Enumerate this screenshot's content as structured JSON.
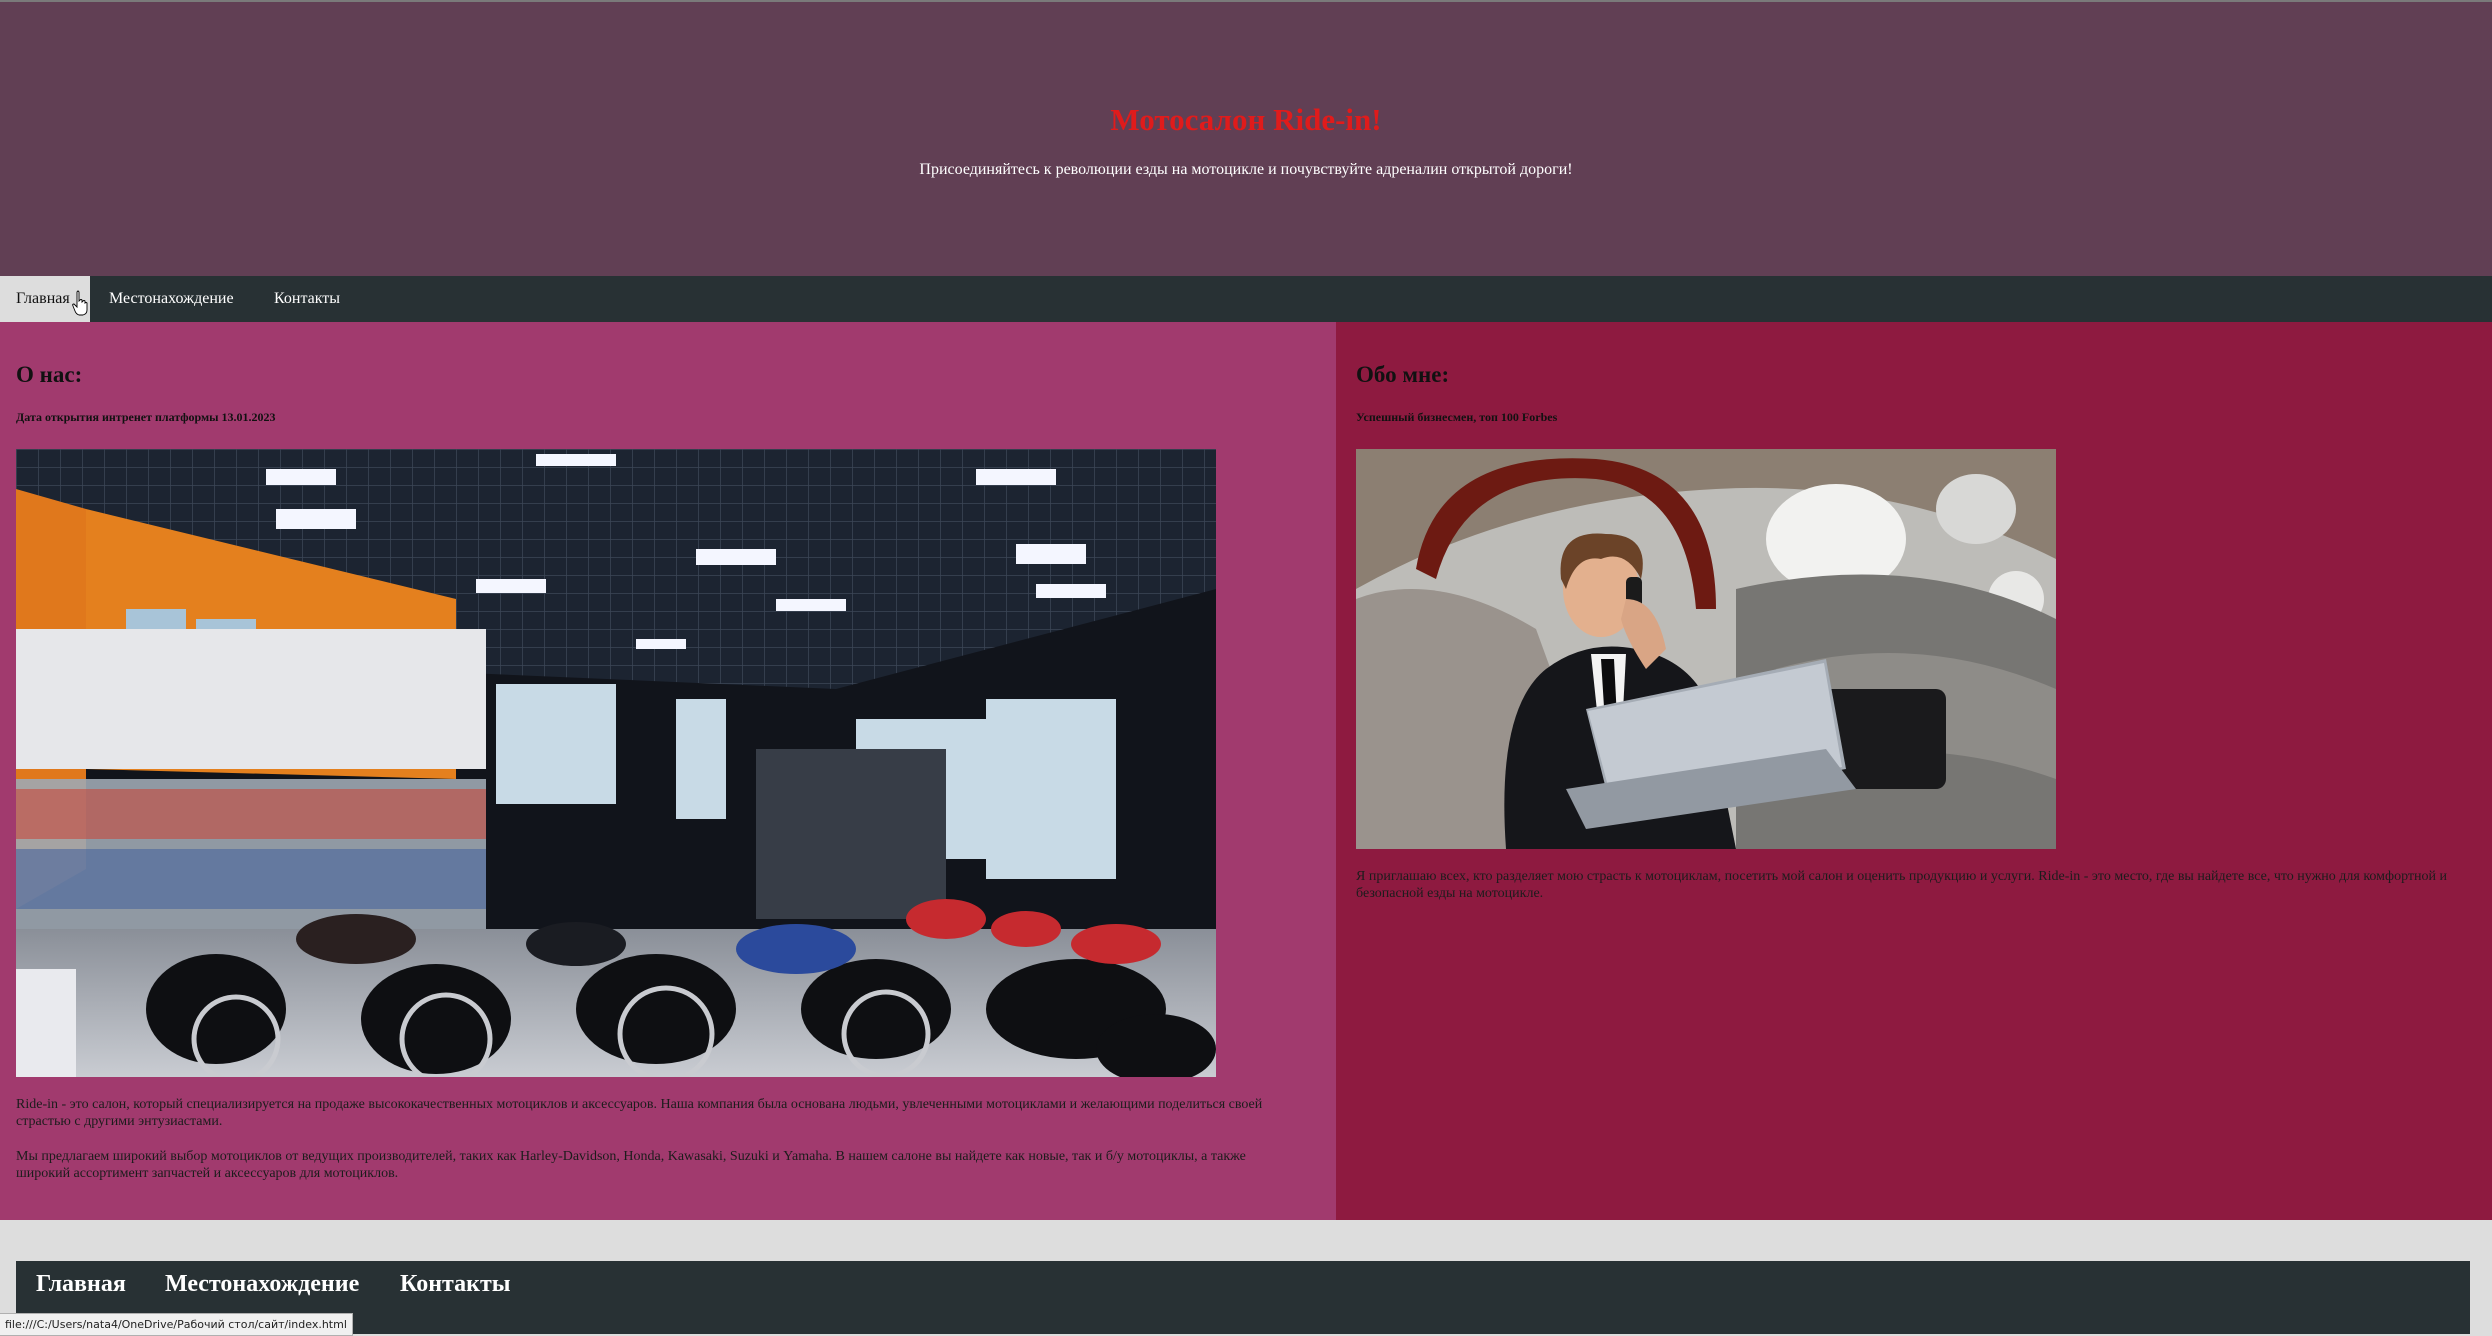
{
  "header": {
    "title": "Мотосалон Ride-in!",
    "subtitle": "Присоединяйтесь к революции езды на мотоцикле и почувствуйте адреналин открытой дороги!"
  },
  "nav": {
    "items": [
      "Главная",
      "Местонахождение",
      "Контакты"
    ],
    "active_index": 0
  },
  "about_us": {
    "heading": "О нас:",
    "subheading": "Дата открытия интренет платформы 13.01.2023",
    "image_alt": "motorcycle-showroom-photo",
    "paragraphs": [
      "Ride-in - это салон, который специализируется на продаже высококачественных мотоциклов и аксессуаров. Наша компания была основана людьми, увлеченными мотоциклами и желающими поделиться своей страстью с другими энтузиастами.",
      "Мы предлагаем широкий выбор мотоциклов от ведущих производителей, таких как Harley-Davidson, Honda, Kawasaki, Suzuki и Yamaha. В нашем салоне вы найдете как новые, так и б/у мотоциклы, а также широкий ассортимент запчастей и аксессуаров для мотоциклов."
    ]
  },
  "about_me": {
    "heading": "Обо мне:",
    "subheading": "Успешный бизнесмен, топ 100 Forbes",
    "image_alt": "businessman-in-limousine-photo",
    "paragraphs": [
      "Я приглашаю всех, кто разделяет мою страсть к мотоциклам, посетить мой салон и оценить продукцию и услуги. Ride-in - это место, где вы найдете все, что нужно для комфортной и безопасной езды на мотоцикле."
    ]
  },
  "footer_nav": {
    "items": [
      "Главная",
      "Местонахождение",
      "Контакты"
    ]
  },
  "status_bar": {
    "url": "file:///C:/Users/nata4/OneDrive/Рабочий стол/сайт/index.html"
  },
  "colors": {
    "header_bg": "#613f54",
    "title": "#e01b1b",
    "nav_bg": "#283134",
    "left_column_bg": "#a13a6e",
    "right_column_bg": "#8e1a40",
    "page_bg": "#dddddd"
  }
}
